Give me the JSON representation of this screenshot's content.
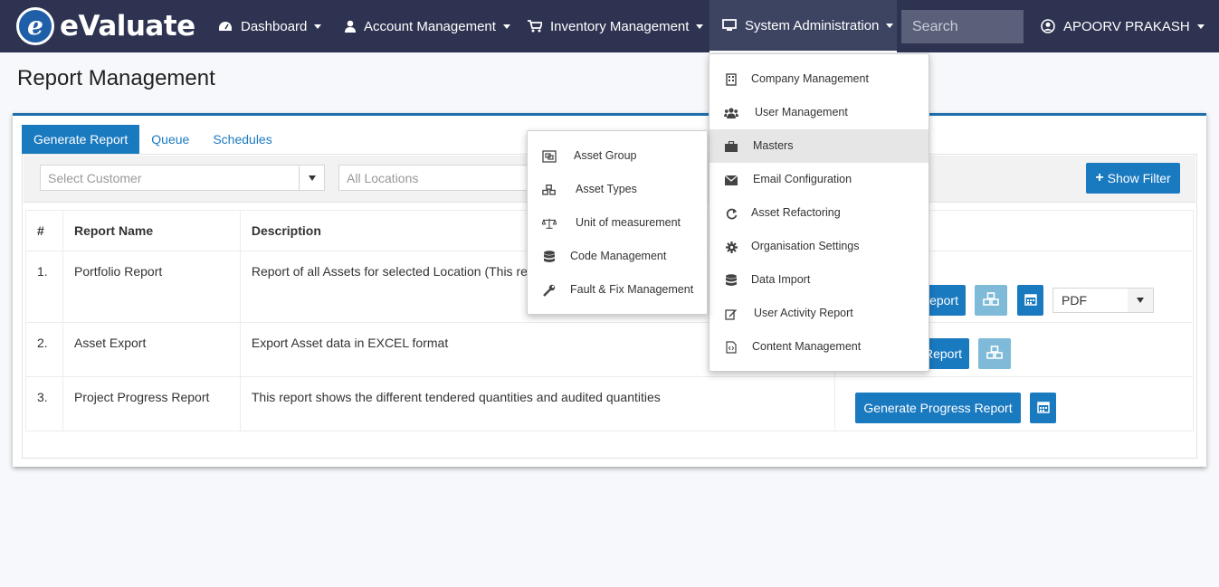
{
  "brand": {
    "name": "eValuate",
    "mark": "e"
  },
  "nav": {
    "dashboard": "Dashboard",
    "account": "Account Management",
    "inventory": "Inventory Management",
    "sysadmin": "System Administration",
    "search_placeholder": "Search",
    "user": "APOORV PRAKASH"
  },
  "page": {
    "title": "Report Management"
  },
  "tabs": [
    "Generate Report",
    "Queue",
    "Schedules"
  ],
  "filters": {
    "customer_placeholder": "Select Customer",
    "location_placeholder": "All Locations",
    "show_filter": "Show Filter"
  },
  "table": {
    "headers": [
      "#",
      "Report Name",
      "Description"
    ],
    "rows": [
      {
        "num": "1.",
        "name": "Portfolio Report",
        "desc": "Report of all Assets for selected Location (This re",
        "button": "eport",
        "format": "PDF"
      },
      {
        "num": "2.",
        "name": "Asset Export",
        "desc": "Export Asset data in EXCEL format",
        "button": "Report"
      },
      {
        "num": "3.",
        "name": "Project Progress Report",
        "desc": "This report shows the different tendered quantities and audited quantities",
        "button": "Generate Progress Report"
      }
    ]
  },
  "sysadmin_menu": [
    {
      "label": "Company Management",
      "icon": "building-icon"
    },
    {
      "label": "User Management",
      "icon": "users-icon"
    },
    {
      "label": "Masters",
      "icon": "briefcase-icon",
      "highlighted": true
    },
    {
      "label": "Email Configuration",
      "icon": "envelope-icon"
    },
    {
      "label": "Asset Refactoring",
      "icon": "refresh-icon"
    },
    {
      "label": "Organisation Settings",
      "icon": "gear-icon"
    },
    {
      "label": "Data Import",
      "icon": "database-icon"
    },
    {
      "label": "User Activity Report",
      "icon": "edit-icon"
    },
    {
      "label": "Content Management",
      "icon": "code-file-icon"
    }
  ],
  "masters_menu": [
    {
      "label": "Asset Group",
      "icon": "object-group-icon"
    },
    {
      "label": "Asset Types",
      "icon": "cubes-icon"
    },
    {
      "label": "Unit of measurement",
      "icon": "balance-scale-icon"
    },
    {
      "label": "Code Management",
      "icon": "database-icon"
    },
    {
      "label": "Fault & Fix Management",
      "icon": "wrench-icon"
    }
  ],
  "colors": {
    "navbar": "#2d3350",
    "primary": "#1a7ac0",
    "light_button": "#7fbad9"
  }
}
